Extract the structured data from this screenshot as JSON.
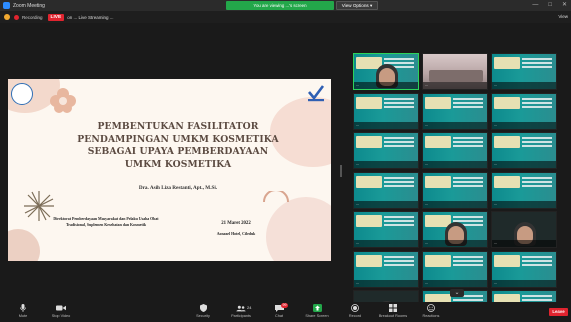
{
  "window": {
    "title": "Zoom Meeting",
    "share_banner": "You are viewing ...'s screen",
    "view_options_label": "View Options ▾",
    "controls": [
      "—",
      "□",
      "✕"
    ]
  },
  "subbar": {
    "recording_label": "Recording",
    "live_label": "LIVE",
    "stream_label": "on ... Live Streaming ...",
    "speaker_view_label": "View"
  },
  "slide": {
    "title": "PEMBENTUKAN FASILITATOR PENDAMPINGAN UMKM KOSMETIKA SEBAGAI UPAYA PEMBERDAYAAN UMKM KOSMETIKA",
    "author": "Dra. Asih Liza Restanti, Apt., M.Si.",
    "organization": "Direktorat Pemberdayaan Masyarakat dan Pelaku Usaha Obat Tradisional, Suplemen Kesehatan dan Kosmetik",
    "date": "21 Maret 2022",
    "venue": "Aonazel Hotel, Cileduk"
  },
  "participants": [
    {
      "name": "...",
      "kind": "hijab",
      "active": true
    },
    {
      "name": "...",
      "kind": "room",
      "active": false
    },
    {
      "name": "...",
      "kind": "slide",
      "active": false
    },
    {
      "name": "...",
      "kind": "slide",
      "active": false
    },
    {
      "name": "...",
      "kind": "slide",
      "active": false
    },
    {
      "name": "...",
      "kind": "slide",
      "active": false
    },
    {
      "name": "...",
      "kind": "slide",
      "active": false
    },
    {
      "name": "...",
      "kind": "slide",
      "active": false
    },
    {
      "name": "...",
      "kind": "slide",
      "active": false
    },
    {
      "name": "...",
      "kind": "slide",
      "active": false
    },
    {
      "name": "...",
      "kind": "slide",
      "active": false
    },
    {
      "name": "...",
      "kind": "slide",
      "active": false
    },
    {
      "name": "...",
      "kind": "slide",
      "active": false
    },
    {
      "name": "...",
      "kind": "glasses",
      "active": false
    },
    {
      "name": "...",
      "kind": "dark-person",
      "active": false
    },
    {
      "name": "...",
      "kind": "slide",
      "active": false
    },
    {
      "name": "...",
      "kind": "slide",
      "active": false
    },
    {
      "name": "...",
      "kind": "slide",
      "active": false
    },
    {
      "name": "...",
      "kind": "dark-person",
      "active": false
    },
    {
      "name": "...",
      "kind": "slide",
      "active": false
    },
    {
      "name": "...",
      "kind": "slide",
      "active": false
    }
  ],
  "toolbar": {
    "items": [
      {
        "label": "Mute",
        "icon": "microphone-icon"
      },
      {
        "label": "Stop Video",
        "icon": "video-camera-icon"
      },
      {
        "label": "Security",
        "icon": "shield-icon"
      },
      {
        "label": "Participants",
        "icon": "participants-icon"
      },
      {
        "label": "Chat",
        "icon": "chat-icon"
      },
      {
        "label": "Share Screen",
        "icon": "share-screen-icon"
      },
      {
        "label": "Record",
        "icon": "record-icon"
      },
      {
        "label": "Breakout Rooms",
        "icon": "breakout-rooms-icon"
      },
      {
        "label": "Reactions",
        "icon": "reactions-icon"
      }
    ],
    "participants_count": "24",
    "chat_badge": "99",
    "end_label": "Leave"
  },
  "colors": {
    "share_banner": "#23a74a",
    "live": "#e0242f",
    "end": "#e0242f",
    "tile_bg": "#0d8a8d",
    "slide_bg": "#fdf7f0",
    "slide_title": "#5b4a41"
  }
}
